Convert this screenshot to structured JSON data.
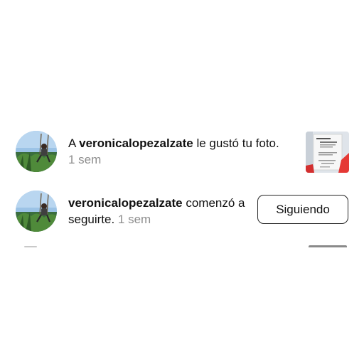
{
  "notifications": [
    {
      "type": "like",
      "prefix": "A ",
      "username": "veronicalopezalzate",
      "action": " le gustó tu foto.",
      "time": "1 sem"
    },
    {
      "type": "follow",
      "username": "veronicalopezalzate",
      "action": " comenzó a seguirte.",
      "time": " 1 sem",
      "button_label": "Siguiendo"
    }
  ],
  "icons": {
    "avatar": "user-avatar-photo",
    "thumbnail": "post-thumbnail-photo"
  }
}
